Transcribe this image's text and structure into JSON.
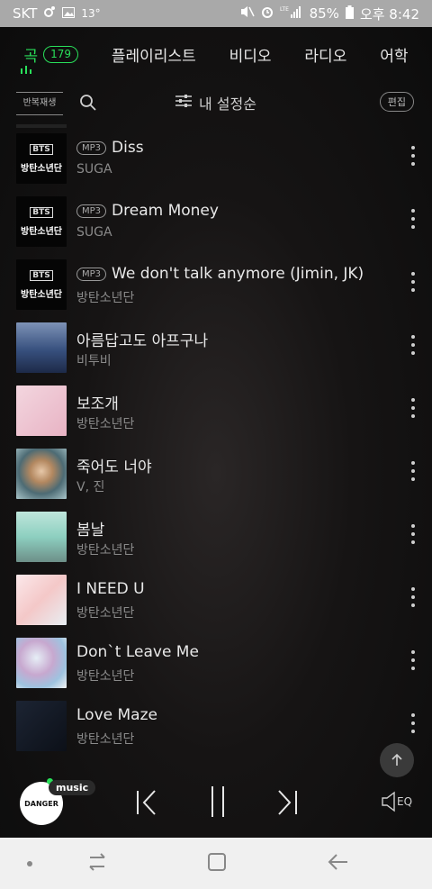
{
  "status_bar": {
    "carrier": "SKT",
    "temperature": "13°",
    "battery": "85%",
    "time": "오후 8:42"
  },
  "tabs": [
    {
      "label": "곡",
      "count": "179",
      "active": true
    },
    {
      "label": "플레이리스트"
    },
    {
      "label": "비디오"
    },
    {
      "label": "라디오"
    },
    {
      "label": "어학"
    }
  ],
  "toolbar": {
    "repeat_label": "반복재생",
    "sort_label": "내 설정순",
    "edit_label": "편집"
  },
  "songs": [
    {
      "title": "Diss",
      "artist": "SUGA",
      "mp3": "MP3",
      "art": "bts"
    },
    {
      "title": "Dream Money",
      "artist": "SUGA",
      "mp3": "MP3",
      "art": "bts"
    },
    {
      "title": "We don't talk anymore (Jimin, JK)",
      "artist": "방탄소년단",
      "mp3": "MP3",
      "art": "bts"
    },
    {
      "title": "아름답고도 아프구나",
      "artist": "비투비",
      "art": "navy"
    },
    {
      "title": "보조개",
      "artist": "방탄소년단",
      "art": "pink"
    },
    {
      "title": "죽어도 너야",
      "artist": "V, 진",
      "art": "portrait"
    },
    {
      "title": "봄날",
      "artist": "방탄소년단",
      "art": "teal"
    },
    {
      "title": "I NEED U",
      "artist": "방탄소년단",
      "art": "pastel"
    },
    {
      "title": "Don`t Leave Me",
      "artist": "방탄소년단",
      "art": "swirl"
    },
    {
      "title": "Love Maze",
      "artist": "방탄소년단",
      "art": "dark"
    }
  ],
  "bts_thumb": {
    "logo": "BTS",
    "text": "방탄소년단"
  },
  "player": {
    "badge": "music",
    "art_text": "DANGER",
    "eq_label": "EQ"
  },
  "colors": {
    "accent": "#29e05a",
    "background": "#0d0d0d",
    "status_bar": "#a9a9a9",
    "nav_bar": "#f0f0f0"
  }
}
